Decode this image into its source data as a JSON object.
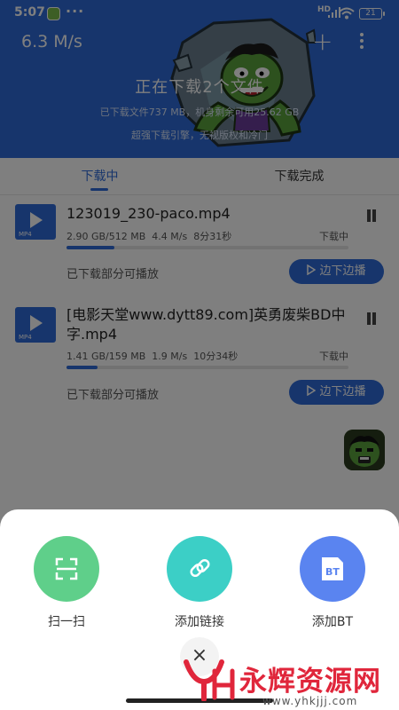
{
  "status_bar": {
    "time": "5:07",
    "more": "···",
    "network": "HD",
    "battery": "21"
  },
  "header": {
    "speed": "6.3 M/s",
    "add_icon": "+",
    "title": "正在下载2个文件",
    "storage": "已下载文件737 MB，机身剩余可用25.62 GB",
    "slogan": "超强下载引擎，无视版权和冷门"
  },
  "tabs": [
    {
      "label": "下载中",
      "active": true
    },
    {
      "label": "下载完成",
      "active": false
    }
  ],
  "downloads": [
    {
      "icon_label": "MP4",
      "name": "123019_230-paco.mp4",
      "size": "2.90 GB/512 MB",
      "speed": "4.4 M/s",
      "remaining": "8分31秒",
      "state": "下载中",
      "progress": 0.17,
      "partial_text": "已下载部分可播放",
      "play_label": "边下边播"
    },
    {
      "icon_label": "MP4",
      "name": "[电影天堂www.dytt89.com]英勇废柴BD中字.mp4",
      "size": "1.41 GB/159 MB",
      "speed": "1.9 M/s",
      "remaining": "10分34秒",
      "state": "下载中",
      "progress": 0.11,
      "partial_text": "已下载部分可播放",
      "play_label": "边下边播"
    }
  ],
  "sheet": {
    "actions": [
      {
        "label": "扫一扫",
        "icon": "scan-icon",
        "color": "#5fcf8a"
      },
      {
        "label": "添加链接",
        "icon": "link-icon",
        "color": "#3ccfc6"
      },
      {
        "label": "添加BT",
        "icon": "bt-file-icon",
        "color": "#5a84f0"
      }
    ],
    "close": "×"
  },
  "watermark": {
    "text": "永辉资源网",
    "url": "www.yhkjjj.com"
  },
  "colors": {
    "primary": "#2f6bd8",
    "brand_red": "#e0263b"
  }
}
